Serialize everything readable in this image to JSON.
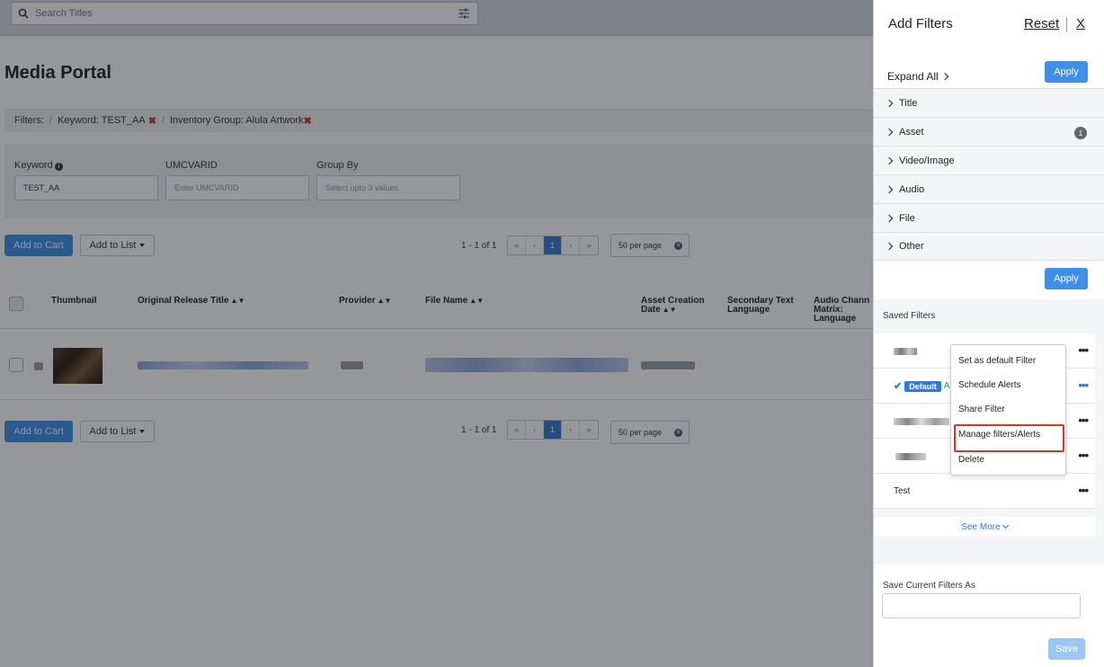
{
  "search": {
    "placeholder": "Search Titles"
  },
  "page": {
    "title": "Media Portal"
  },
  "filters_bar": {
    "label": "Filters:",
    "chips": [
      {
        "label": "Keyword: TEST_AA"
      },
      {
        "label": "Inventory Group: Alula Artwork"
      }
    ]
  },
  "search_fields": {
    "keyword": {
      "label": "Keyword",
      "value": "TEST_AA"
    },
    "umcvarid": {
      "label": "UMCVARID",
      "placeholder": "Enter UMCVARID"
    },
    "group_by": {
      "label": "Group By",
      "placeholder": "Select upto 3 values"
    }
  },
  "toolbar": {
    "add_to_cart": "Add to Cart",
    "add_to_list": "Add to List",
    "range": "1 - 1 of 1",
    "pager": [
      "«",
      "‹",
      "1",
      "›",
      "»"
    ],
    "per_page": "50 per page"
  },
  "table": {
    "headers": {
      "thumbnail": "Thumbnail",
      "original_release_title": "Original Release Title",
      "provider": "Provider",
      "file_name": "File Name",
      "asset_creation_date_1": "Asset Creation",
      "asset_creation_date_2": "Date",
      "secondary_text_language_1": "Secondary Text",
      "secondary_text_language_2": "Language",
      "audio_channel_1": "Audio Chann",
      "audio_channel_2": "Matrix:",
      "audio_channel_3": "Language"
    }
  },
  "drawer": {
    "title": "Add Filters",
    "reset": "Reset",
    "close": "X",
    "expand_all": "Expand All",
    "apply": "Apply",
    "categories": [
      {
        "label": "Title"
      },
      {
        "label": "Asset",
        "badge": "1"
      },
      {
        "label": "Video/Image"
      },
      {
        "label": "Audio"
      },
      {
        "label": "File"
      },
      {
        "label": "Other"
      }
    ],
    "saved_filters_title": "Saved Filters",
    "default_badge": "Default",
    "default_suffix": "A",
    "saved_last_name": "Test",
    "see_more": "See More",
    "save_as_label": "Save Current Filters As",
    "save": "Save"
  },
  "context_menu": {
    "items": [
      "Set as default Filter",
      "Schedule Alerts",
      "Share Filter",
      "Manage filters/Alerts",
      "Delete"
    ]
  },
  "colors": {
    "primary": "#3d8fe8",
    "highlight_border": "#d9332b",
    "link": "#2f7ad8"
  }
}
